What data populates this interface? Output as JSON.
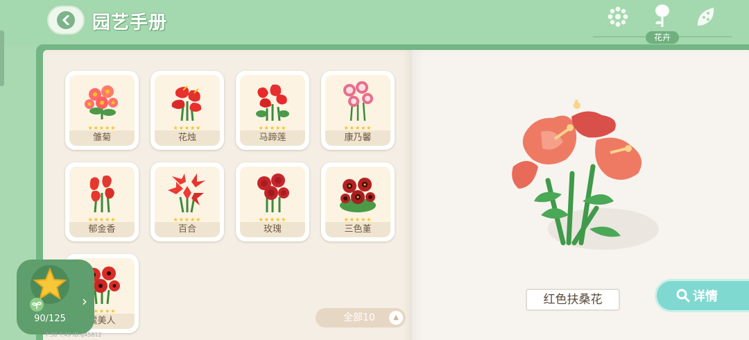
{
  "header": {
    "title": "园艺手册",
    "active_category": "花卉",
    "category_icons": [
      "seed-icon",
      "flower-icon",
      "leaf-icon"
    ]
  },
  "flowers": [
    {
      "name": "雏菊",
      "color": "#ff6b6b",
      "stars": "★★★★★"
    },
    {
      "name": "花烛",
      "color": "#e8302d",
      "stars": "★★★★★"
    },
    {
      "name": "马蹄莲",
      "color": "#e82a2a",
      "stars": "★★★★★"
    },
    {
      "name": "康乃馨",
      "color": "#e86e8a",
      "stars": "★★★★★"
    },
    {
      "name": "郁金香",
      "color": "#e5392f",
      "stars": "★★★★★"
    },
    {
      "name": "百合",
      "color": "#ec3a35",
      "stars": "★★★★★"
    },
    {
      "name": "玫瑰",
      "color": "#c8262b",
      "stars": "★★★★★"
    },
    {
      "name": "三色堇",
      "color": "#b42222",
      "stars": "★★★★★"
    },
    {
      "name": "虞美人",
      "color": "#d82c28",
      "stars": "★★★★★"
    }
  ],
  "filter": {
    "label": "全部10"
  },
  "progress": {
    "count": "90/125"
  },
  "detail": {
    "selected_name": "红色扶桑花",
    "button_label": "详情"
  },
  "debug_text": "F:30 T:49 ID:q45812"
}
